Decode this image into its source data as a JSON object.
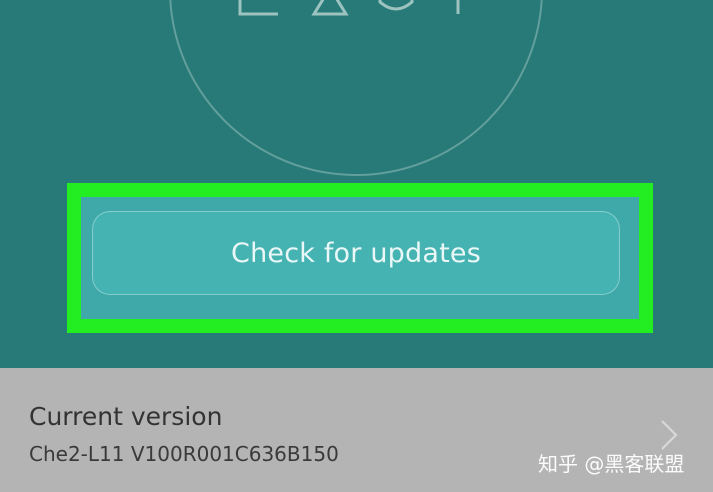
{
  "main": {
    "check_updates_label": "Check for updates"
  },
  "version": {
    "title": "Current version",
    "value": "Che2-L11 V100R001C636B150"
  },
  "watermark": {
    "text": "知乎 @黑客联盟"
  },
  "colors": {
    "header_bg": "#277a77",
    "button_bg": "#46b3b3",
    "highlight": "#22ee22",
    "footer_bg": "#b4b4b4"
  },
  "icons": {
    "logo": "emui-logo-icon",
    "chevron": "chevron-right-icon"
  }
}
